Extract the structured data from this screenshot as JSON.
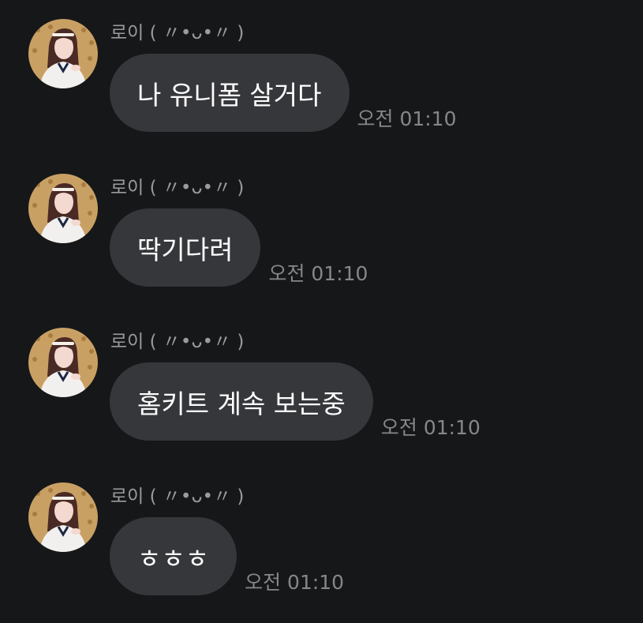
{
  "sender": {
    "name": "로이 ( 〃•ᴗ•〃 )"
  },
  "messages": [
    {
      "text": "나 유니폼 살거다",
      "time": "오전 01:10"
    },
    {
      "text": "딱기다려",
      "time": "오전 01:10"
    },
    {
      "text": "홈키트 계속 보는중",
      "time": "오전 01:10"
    },
    {
      "text": "ㅎㅎㅎ",
      "time": "오전 01:10"
    }
  ],
  "colors": {
    "background": "#161719",
    "bubble": "#36373b",
    "sender_text": "#9a9b9f",
    "time_text": "#86878b",
    "message_text": "#ffffff"
  },
  "icons": {
    "avatar": "profile-photo-avatar"
  }
}
